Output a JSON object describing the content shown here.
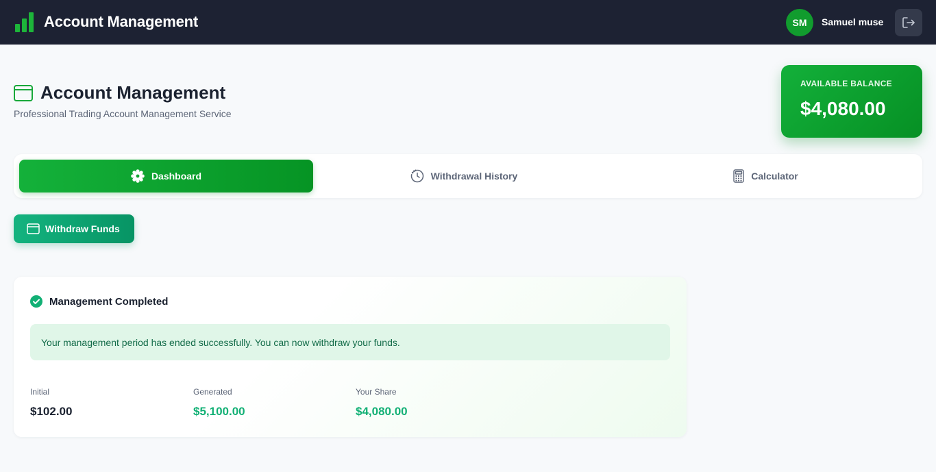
{
  "app": {
    "title": "Account Management",
    "user_initials": "SM",
    "user_name": "Samuel muse"
  },
  "page": {
    "title": "Account Management",
    "subtitle": "Professional Trading Account Management Service"
  },
  "balance": {
    "label": "AVAILABLE BALANCE",
    "value": "$4,080.00"
  },
  "tabs": [
    {
      "label": "Dashboard",
      "icon": "gear-icon",
      "active": true
    },
    {
      "label": "Withdrawal History",
      "icon": "clock-icon",
      "active": false
    },
    {
      "label": "Calculator",
      "icon": "calculator-icon",
      "active": false
    }
  ],
  "actions": {
    "withdraw_label": "Withdraw Funds"
  },
  "status": {
    "title": "Management Completed",
    "message": "Your management period has ended successfully. You can now withdraw your funds.",
    "stats": [
      {
        "label": "Initial",
        "value": "$102.00"
      },
      {
        "label": "Generated",
        "value": "$5,100.00"
      },
      {
        "label": "Your Share",
        "value": "$4,080.00"
      }
    ]
  },
  "colors": {
    "topbar": "#1d2233",
    "brand_green": "#14b13a",
    "teal": "#12b075",
    "page_bg": "#f7f9fb"
  }
}
